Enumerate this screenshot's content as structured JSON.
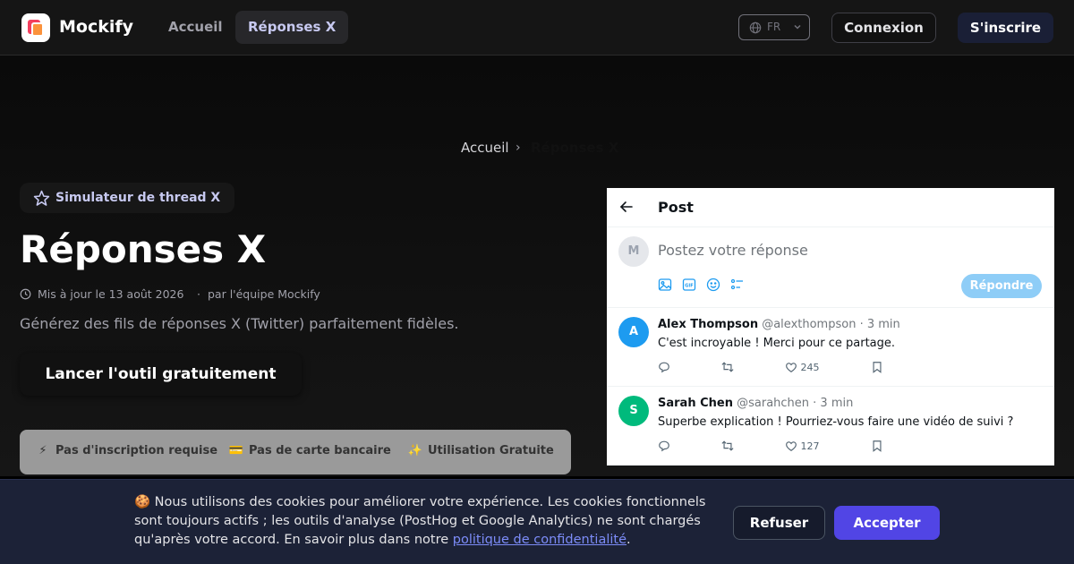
{
  "header": {
    "brand": "Mockify",
    "nav": [
      {
        "label": "Accueil"
      },
      {
        "label": "Réponses X"
      }
    ],
    "lang": "FR",
    "login": "Connexion",
    "signup": "S'inscrire"
  },
  "hero": {
    "breadcrumb": {
      "home": "Accueil",
      "separator": "›",
      "current": "Réponses X"
    },
    "badge": "Simulateur de thread X",
    "title": "Réponses X",
    "meta": {
      "updated": "Mis à jour le 13 août 2026",
      "dot": "·",
      "author": "par l'équipe Mockify"
    },
    "subtitle": "Générez des fils de réponses X (Twitter) parfaitement fidèles.",
    "cta": "Lancer l'outil gratuitement",
    "features": [
      {
        "icon": "⚡",
        "label": "Pas d'inscription requise"
      },
      {
        "icon": "💳",
        "label": "Pas de carte bancaire"
      },
      {
        "icon": "✨",
        "label": "Utilisation Gratuite"
      }
    ]
  },
  "xmock": {
    "header_title": "Post",
    "composer": {
      "avatar": "M",
      "placeholder": "Postez votre réponse",
      "reply_button": "Répondre"
    },
    "posts": [
      {
        "avatar": "A",
        "avatar_color": "#1d9bf0",
        "name": "Alex Thompson",
        "handle": "@alexthompson",
        "time": "· 3 min",
        "text": "C'est incroyable ! Merci pour ce partage.",
        "likes": "245"
      },
      {
        "avatar": "S",
        "avatar_color": "#00ba7c",
        "name": "Sarah Chen",
        "handle": "@sarahchen",
        "time": "· 3 min",
        "text": "Superbe explication ! Pourriez-vous faire une vidéo de suivi ?",
        "likes": "127"
      }
    ]
  },
  "cookie": {
    "emoji": "🍪",
    "text": "Nous utilisons des cookies pour améliorer votre expérience. Les cookies fonctionnels sont toujours actifs ; les outils d'analyse (PostHog et Google Analytics) ne sont chargés qu'après votre accord. En savoir plus dans notre",
    "link": "politique de confidentialité",
    "end": ".",
    "refuse": "Refuser",
    "accept": "Accepter"
  },
  "colors": {
    "accent": "#5145e5",
    "x_blue": "#1d9bf0",
    "x_green": "#00ba7c"
  }
}
